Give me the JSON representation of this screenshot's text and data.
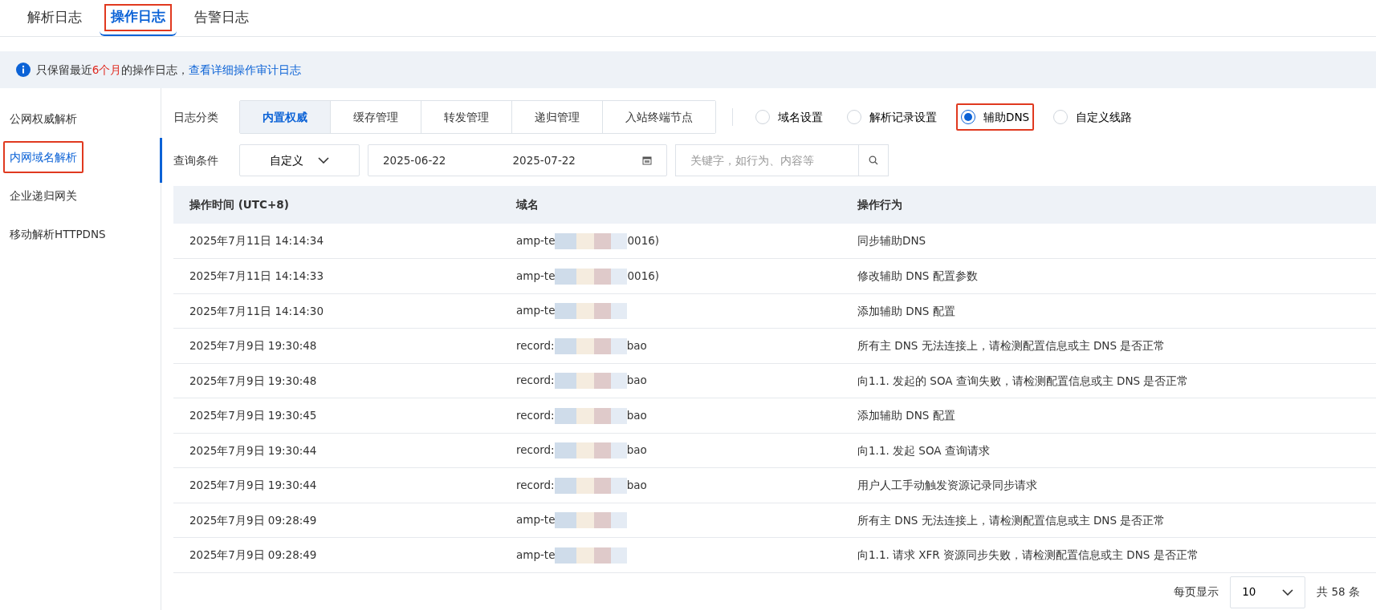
{
  "tabs": [
    {
      "label": "解析日志",
      "selected": false,
      "annotated": false
    },
    {
      "label": "操作日志",
      "selected": true,
      "annotated": true
    },
    {
      "label": "告警日志",
      "selected": false,
      "annotated": false
    }
  ],
  "notice": {
    "text": "只保留最近**6个月**的操作日志，",
    "link": "查看详细操作审计日志"
  },
  "sidebar": {
    "items": [
      {
        "label": "公网权威解析",
        "selected": false,
        "annotated": false
      },
      {
        "label": "内网域名解析",
        "selected": true,
        "annotated": true
      },
      {
        "label": "企业递归网关",
        "selected": false,
        "annotated": false
      },
      {
        "label": "移动解析HTTPDNS",
        "selected": false,
        "annotated": false
      }
    ]
  },
  "filters": {
    "category_label": "日志分类",
    "categories": [
      {
        "label": "内置权威",
        "selected": true
      },
      {
        "label": "缓存管理",
        "selected": false
      },
      {
        "label": "转发管理",
        "selected": false
      },
      {
        "label": "递归管理",
        "selected": false
      },
      {
        "label": "入站终端节点",
        "selected": false
      }
    ],
    "radios": [
      {
        "label": "域名设置",
        "selected": false,
        "annotated": false
      },
      {
        "label": "解析记录设置",
        "selected": false,
        "annotated": false
      },
      {
        "label": "辅助DNS",
        "selected": true,
        "annotated": true
      },
      {
        "label": "自定义线路",
        "selected": false,
        "annotated": false
      }
    ],
    "query_label": "查询条件",
    "range_select": "自定义",
    "date_from": "2025-06-22",
    "date_to": "2025-07-22",
    "search": {
      "placeholder": "关键字，如行为、内容等"
    }
  },
  "table": {
    "columns": [
      "操作时间 (UTC+8)",
      "域名",
      "操作行为"
    ],
    "rows": [
      {
        "time": "2025年7月11日 14:14:34",
        "domain_start": "amp-te",
        "domain_end": "0016)",
        "action": "同步辅助DNS"
      },
      {
        "time": "2025年7月11日 14:14:33",
        "domain_start": "amp-te",
        "domain_end": "0016)",
        "action": "修改辅助 DNS 配置参数"
      },
      {
        "time": "2025年7月11日 14:14:30",
        "domain_start": "amp-te",
        "action": "添加辅助 DNS 配置"
      },
      {
        "time": "2025年7月9日 19:30:48",
        "domain_start": "record:",
        "domain_end": "bao",
        "action": "所有主 DNS 无法连接上，请检测配置信息或主 DNS 是否正常"
      },
      {
        "time": "2025年7月9日 19:30:48",
        "domain_start": "record:",
        "domain_end": "bao",
        "action": "向1.1.    发起的 SOA 查询失败，请检测配置信息或主 DNS 是否正常"
      },
      {
        "time": "2025年7月9日 19:30:45",
        "domain_start": "record:",
        "domain_end": "bao",
        "action": "添加辅助 DNS 配置"
      },
      {
        "time": "2025年7月9日 19:30:44",
        "domain_start": "record:",
        "domain_end": "bao",
        "action": "向1.1.    发起 SOA 查询请求"
      },
      {
        "time": "2025年7月9日 19:30:44",
        "domain_start": "record:",
        "domain_end": "bao",
        "action": "用户人工手动触发资源记录同步请求"
      },
      {
        "time": "2025年7月9日 09:28:49",
        "domain_start": "amp-te",
        "action": "所有主 DNS 无法连接上，请检测配置信息或主 DNS 是否正常"
      },
      {
        "time": "2025年7月9日 09:28:49",
        "domain_start": "amp-te",
        "action": "向1.1.    请求 XFR 资源同步失败，请检测配置信息或主 DNS 是否正常"
      }
    ]
  },
  "pagination": {
    "per_page_label": "每页显示",
    "per_page": "10",
    "total": "共 58 条"
  }
}
